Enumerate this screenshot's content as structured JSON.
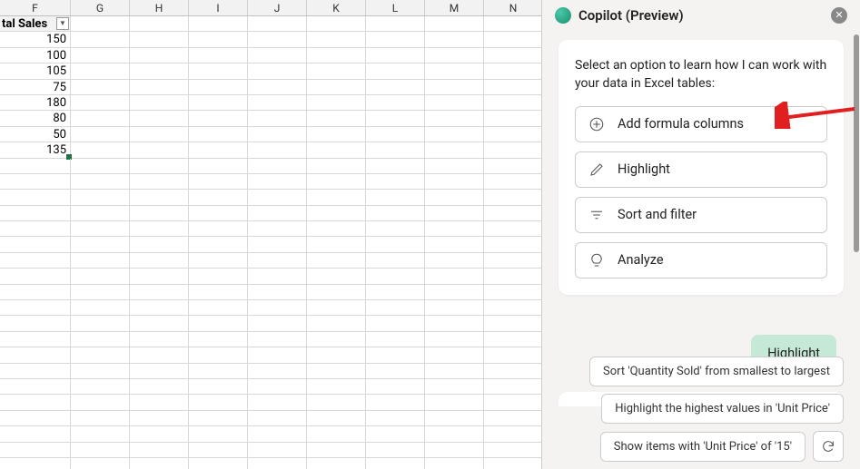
{
  "sheet": {
    "columns": [
      "F",
      "G",
      "H",
      "I",
      "J",
      "K",
      "L",
      "M",
      "N"
    ],
    "header_cell": "tal Sales",
    "values": [
      150,
      100,
      105,
      75,
      180,
      80,
      50,
      135
    ]
  },
  "panel": {
    "title": "Copilot (Preview)",
    "prompt": "Select an option to learn how I can work with your data in Excel tables:",
    "options": [
      {
        "key": "add",
        "label": "Add formula columns"
      },
      {
        "key": "highlight",
        "label": "Highlight"
      },
      {
        "key": "sort",
        "label": "Sort and filter"
      },
      {
        "key": "analyze",
        "label": "Analyze"
      }
    ],
    "user_message": "Highlight",
    "partial_response": "",
    "suggestions": [
      "Sort 'Quantity Sold' from smallest to largest",
      "Highlight the highest values in 'Unit Price'",
      "Show items with 'Unit Price' of '15'"
    ]
  }
}
